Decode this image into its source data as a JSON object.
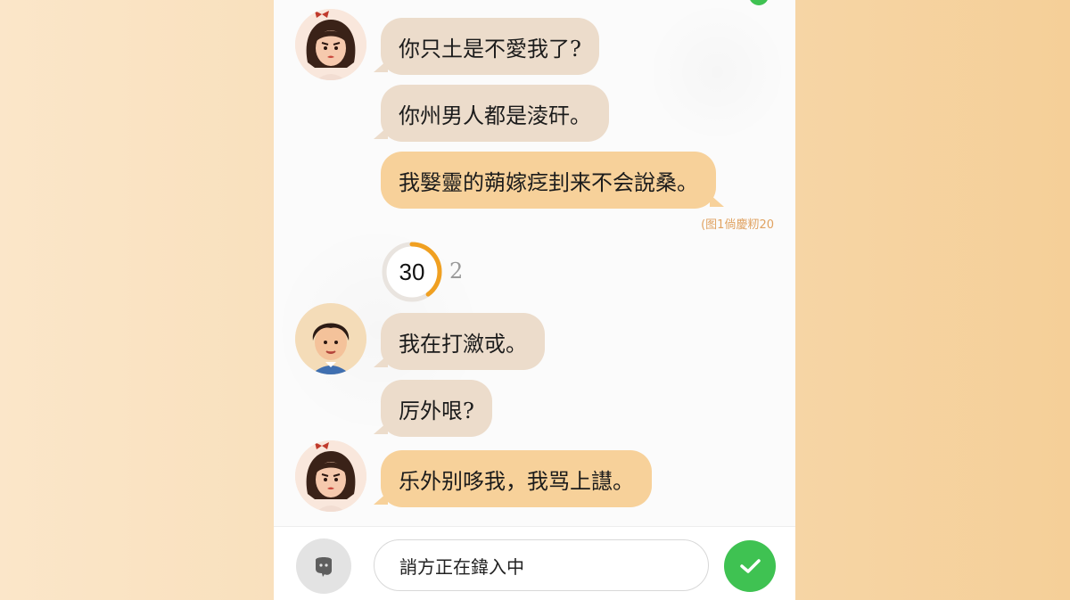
{
  "messages": [
    {
      "text": "你只土是不愛我了?"
    },
    {
      "text": "你州男人都是淩矸。"
    },
    {
      "text": "我嫛靈的蒴嫁疺刲来不会說桑。"
    },
    {
      "text": "我在打瀲戓。"
    },
    {
      "text": "厉外哏?"
    },
    {
      "text": "乐外别哆我，我骂上譿。"
    }
  ],
  "timestamp": "(图1倘慶籾20",
  "timer": {
    "value": "30",
    "side_glyph": "2",
    "progress_percent": 40
  },
  "input": {
    "placeholder": "誚方正在鍏入中"
  },
  "colors": {
    "gray_bubble": "#ecdccb",
    "yellow_bubble": "#f7d19a",
    "send_green": "#3fc252",
    "timer_orange": "#f0a021"
  },
  "icons": {
    "voice": "voice-icon",
    "send": "checkmark-icon"
  }
}
